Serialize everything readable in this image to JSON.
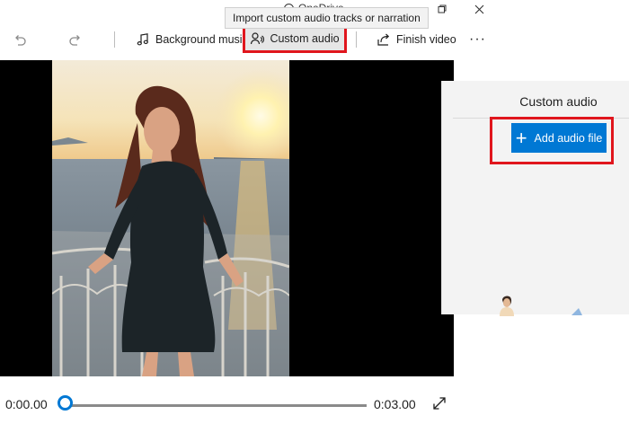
{
  "window": {
    "title": "OneDrive"
  },
  "toolbar": {
    "background_music": "Background music",
    "custom_audio": "Custom audio",
    "finish_video": "Finish video",
    "more": "···"
  },
  "tooltip": {
    "text": "Import custom audio tracks or narration"
  },
  "panel": {
    "title": "Custom audio",
    "add_button": "Add audio file"
  },
  "playback": {
    "current_time": "0:00.00",
    "total_time": "0:03.00",
    "progress": 0
  },
  "colors": {
    "accent": "#0078d4",
    "highlight": "#e0161d"
  },
  "icons": [
    "undo-icon",
    "redo-icon",
    "music-note-icon",
    "custom-audio-icon",
    "share-icon",
    "more-icon",
    "plus-icon",
    "expand-icon"
  ]
}
